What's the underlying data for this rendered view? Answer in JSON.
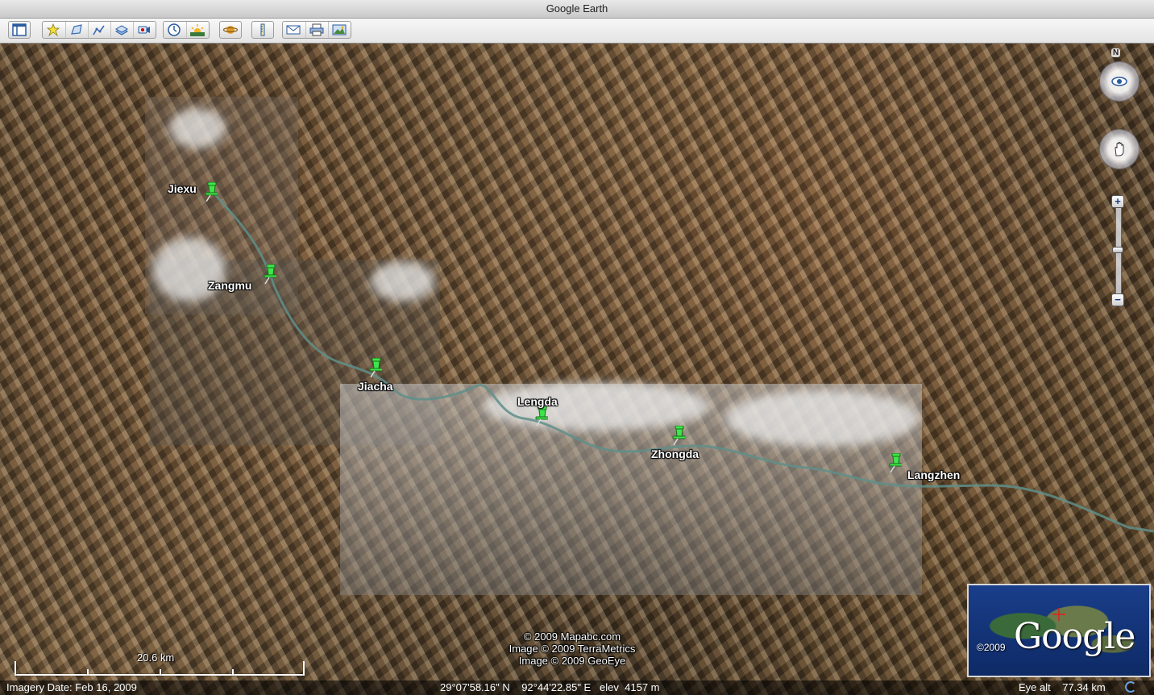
{
  "window": {
    "title": "Google Earth"
  },
  "toolbar": {
    "buttons": [
      {
        "icon": "sidebar-icon"
      },
      {
        "icon": "placemark-icon"
      },
      {
        "icon": "polygon-icon"
      },
      {
        "icon": "path-icon"
      },
      {
        "icon": "image-overlay-icon"
      },
      {
        "icon": "record-tour-icon"
      },
      {
        "icon": "historical-imagery-icon"
      },
      {
        "icon": "sunlight-icon"
      },
      {
        "icon": "planets-icon"
      },
      {
        "icon": "ruler-icon"
      },
      {
        "icon": "email-icon"
      },
      {
        "icon": "print-icon"
      },
      {
        "icon": "save-image-icon"
      }
    ]
  },
  "map": {
    "placemarks": [
      {
        "name": "Jiexu"
      },
      {
        "name": "Zangmu"
      },
      {
        "name": "Jiacha"
      },
      {
        "name": "Lengda"
      },
      {
        "name": "Zhongda"
      },
      {
        "name": "Langzhen"
      }
    ],
    "credits": [
      "© 2009 Mapabc.com",
      "Image © 2009 TerraMetrics",
      "Image © 2009 GeoEye"
    ],
    "scale_label": "20.6 km",
    "navigation": {
      "north_label": "N",
      "zoom_in": "+",
      "zoom_out": "−"
    },
    "overview": {
      "logo": "Google",
      "year": "©2009"
    }
  },
  "status": {
    "imagery_date": "Imagery Date: Feb 16, 2009",
    "coordinates": "29°07'58.16\" N    92°44'22.85\" E   elev  4157 m",
    "eye_alt": "Eye alt    77.34 km"
  },
  "colors": {
    "pin": "#3ee64a",
    "river": "#5f8f8a"
  }
}
